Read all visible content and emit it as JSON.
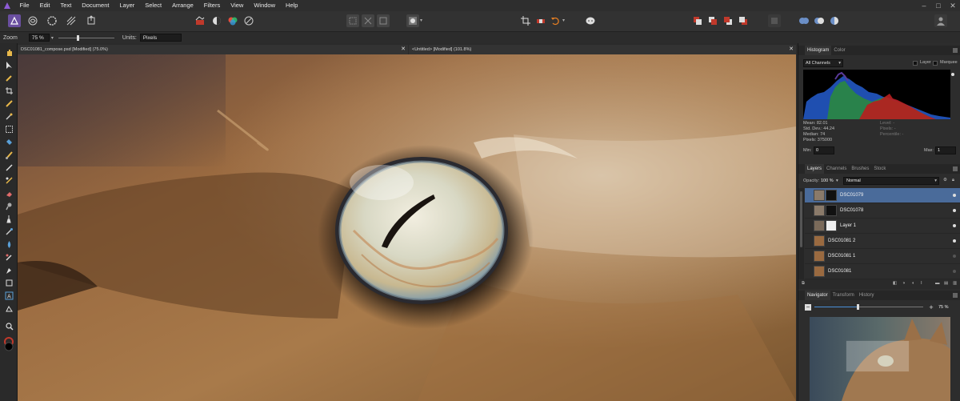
{
  "menu": {
    "items": [
      "File",
      "Edit",
      "Text",
      "Document",
      "Layer",
      "Select",
      "Arrange",
      "Filters",
      "View",
      "Window",
      "Help"
    ]
  },
  "toolbar": {
    "personas": [
      "photo-persona-icon",
      "liquify-persona-icon",
      "develop-persona-icon",
      "export-persona-icon"
    ],
    "accent": "#c0392b"
  },
  "context": {
    "zoom_label": "Zoom",
    "zoom_value": "75 %",
    "zoom_level": 0.35,
    "units_label": "Units:",
    "units_value": "Pixels"
  },
  "tabs": {
    "doc1": "DSC01081_compose.psd [Modified] (75.0%)",
    "doc2": "<Untitled> [Modified] (101.8%)"
  },
  "histogram": {
    "tabs": [
      "Histogram",
      "Color"
    ],
    "channel": "All Channels",
    "layer_label": "Layer",
    "marquee_label": "Marquee",
    "stats": {
      "mean": "Mean: 82.01",
      "std": "Std. Dev.: 44.24",
      "median": "Median: 74",
      "pixels": "Pixels: 375000",
      "level": "Level: -",
      "pixels_right": "Pixels: -",
      "percentile": "Percentile: -"
    },
    "min_label": "Min:",
    "min_value": "0",
    "max_label": "Max:",
    "max_value": "1"
  },
  "layers": {
    "tabs": [
      "Layers",
      "Channels",
      "Brushes",
      "Stock"
    ],
    "opacity_label": "Opacity:",
    "opacity_value": "100 %",
    "blend_mode": "Normal",
    "items": [
      {
        "name": "DSC01079",
        "selected": true
      },
      {
        "name": "DSC01078",
        "selected": false
      },
      {
        "name": "Layer 1",
        "selected": false
      },
      {
        "name": "DSC01081 2",
        "selected": false
      },
      {
        "name": "DSC01081 1",
        "selected": false
      },
      {
        "name": "DSC01081",
        "selected": false
      }
    ]
  },
  "navigator": {
    "tabs": [
      "Navigator",
      "Transform",
      "History"
    ],
    "zoom_value": "75 %",
    "zoom_level": 0.4
  }
}
